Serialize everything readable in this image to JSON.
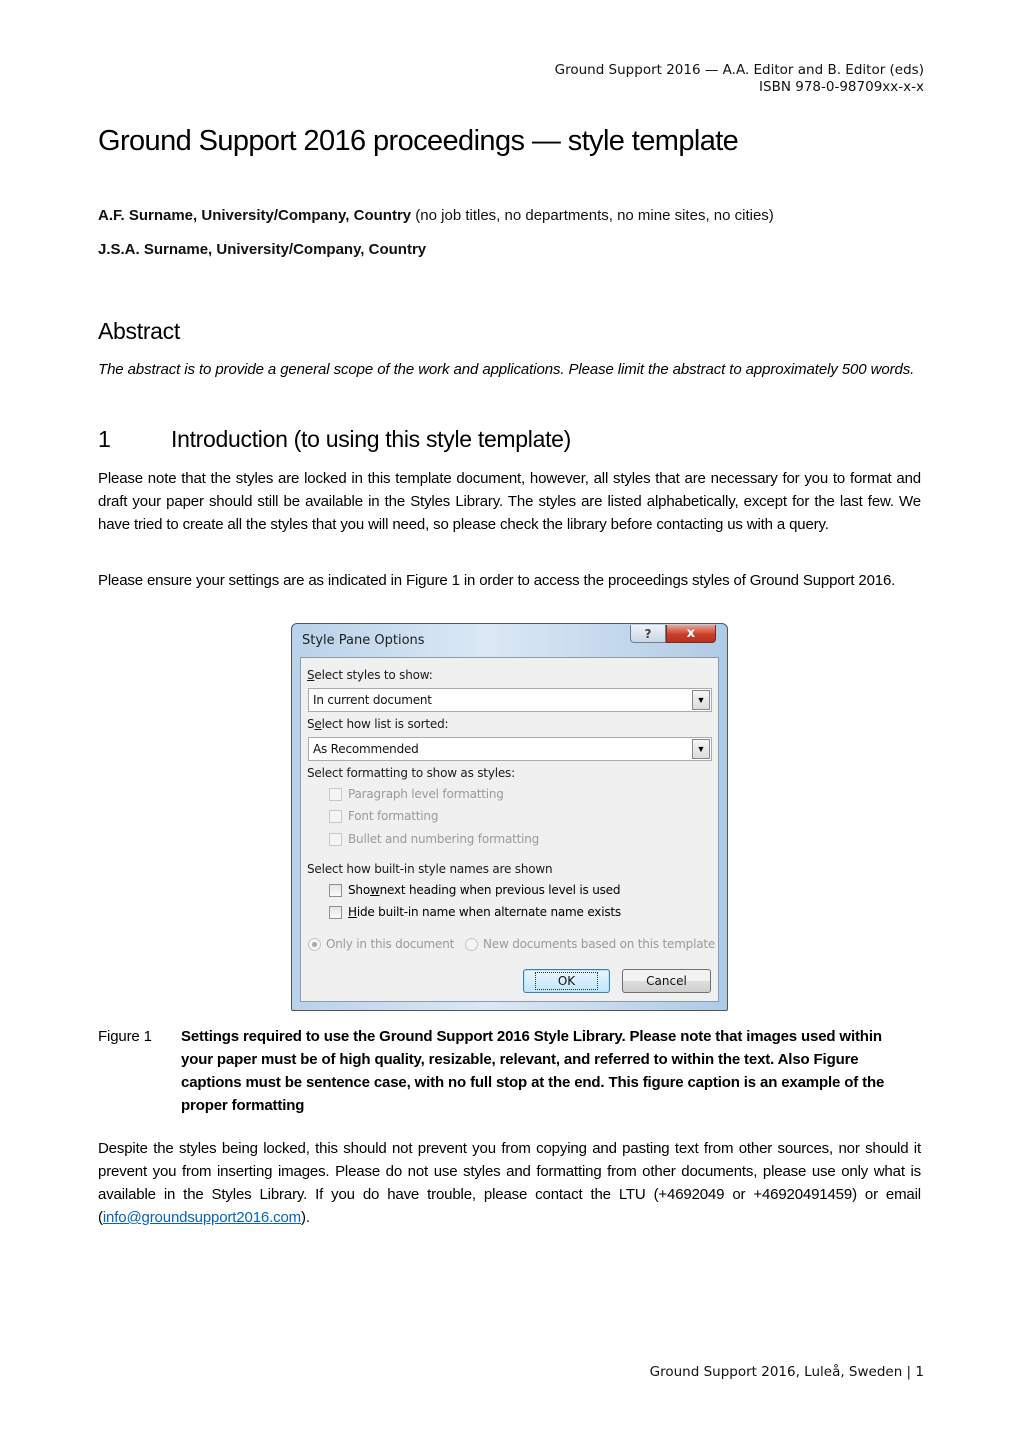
{
  "header": {
    "line1": "Ground Support 2016 — A.A. Editor and B. Editor (eds)",
    "line2": "ISBN 978-0-98709xx-x-x"
  },
  "title": "Ground Support 2016 proceedings — style template",
  "authors": [
    {
      "name": "A.F. Surname, University/Company, Country",
      "note": " (no job titles, no departments, no mine sites, no cities)"
    },
    {
      "name": "J.S.A. Surname, University/Company, Country",
      "note": ""
    }
  ],
  "abstract": {
    "heading": "Abstract",
    "text": "The abstract is to provide a general scope of the work and applications. Please limit the abstract to approximately 500 words."
  },
  "section1": {
    "number": "1",
    "heading": "Introduction (to using this style template)",
    "paragraphs": [
      "Please note that the styles are locked in this template document, however, all styles that are necessary for you to format and draft your paper should still be available in the Styles Library. The styles are listed alphabetically, except for the last few. We have tried to create all the styles that you will need, so please check the library before contacting us with a query.",
      "Please ensure your settings are as indicated in Figure 1 in order to access the proceedings styles of Ground Support 2016."
    ]
  },
  "dialog": {
    "title": "Style Pane Options",
    "help_glyph": "?",
    "close_glyph": "x",
    "styles_to_show": {
      "label_u": "S",
      "label_rest": "elect styles to show:",
      "value": "In current document"
    },
    "sort": {
      "label_pre": "S",
      "label_u": "e",
      "label_rest": "lect how list is sorted:",
      "value": "As Recommended"
    },
    "dropdown_arrow": "▼",
    "formatting_label": "Select formatting to show as styles:",
    "formatting_options": [
      {
        "label": "Paragraph level formatting",
        "checked": false,
        "disabled": true
      },
      {
        "label": "Font formatting",
        "checked": false,
        "disabled": true
      },
      {
        "label": "Bullet and numbering formatting",
        "checked": false,
        "disabled": true
      }
    ],
    "builtin_label": "Select how built-in style names are shown",
    "builtin_options": [
      {
        "pre": "Sho",
        "u": "w",
        "rest": " next heading when previous level is used",
        "checked": false
      },
      {
        "pre": "",
        "u": "H",
        "rest": "ide built-in name when alternate name exists",
        "checked": false
      }
    ],
    "scope_options": [
      {
        "label": "Only in this document",
        "selected": true,
        "disabled": true
      },
      {
        "label": "New documents based on this template",
        "selected": false,
        "disabled": true
      }
    ],
    "ok_label": "OK",
    "cancel_label": "Cancel"
  },
  "figure": {
    "label": "Figure 1",
    "caption": "Settings required to use the Ground Support 2016 Style Library. Please note that images used within your paper must be of high quality, resizable, relevant, and referred to within the text. Also Figure captions must be sentence case, with no full stop at the end. This figure caption is an example of the proper formatting"
  },
  "closing": {
    "text_before": "Despite the styles being locked, this should not prevent you from copying and pasting text from other sources, nor should it prevent you from inserting images. Please do not use styles and formatting from other documents, please use only what is available in the Styles Library. If you do have trouble, please contact the LTU (+4692049 or +46920491459) or email (",
    "email": "info@groundsupport2016.com",
    "text_after": ")."
  },
  "footer": "Ground Support 2016, Luleå, Sweden | 1",
  "colors": {
    "link": "#0563c1",
    "close_button": "#c9402a"
  }
}
